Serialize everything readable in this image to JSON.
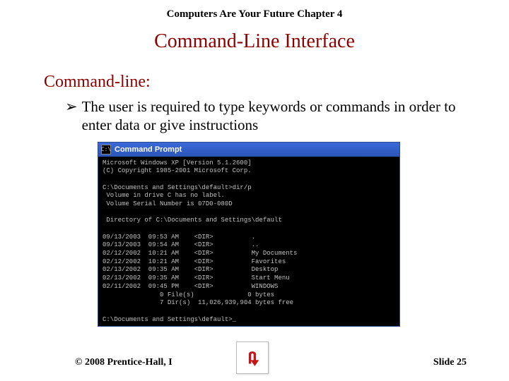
{
  "chapter_header": "Computers Are Your Future  Chapter 4",
  "slide_title": "Command-Line Interface",
  "section_heading": "Command-line:",
  "bullet_glyph": "➢",
  "bullet_text": "The user is required to type keywords or commands in order to enter data or give instructions",
  "cmd_window": {
    "icon_text": "C:\\",
    "title": "Command Prompt",
    "body": "Microsoft Windows XP [Version 5.1.2600]\n(C) Copyright 1985-2001 Microsoft Corp.\n\nC:\\Documents and Settings\\default>dir/p\n Volume in drive C has no label.\n Volume Serial Number is 07D0-080D\n\n Directory of C:\\Documents and Settings\\default\n\n09/13/2003  09:53 AM    <DIR>          .\n09/13/2003  09:54 AM    <DIR>          ..\n02/12/2002  10:21 AM    <DIR>          My Documents\n02/12/2002  10:21 AM    <DIR>          Favorites\n02/13/2002  09:35 AM    <DIR>          Desktop\n02/13/2002  09:35 AM    <DIR>          Start Menu\n02/11/2002  09:45 PM    <DIR>          WINDOWS\n               0 File(s)              0 bytes\n               7 Dir(s)  11,026,939,904 bytes free\n\nC:\\Documents and Settings\\default>_"
  },
  "footer": {
    "copyright": "© 2008 Prentice-Hall, I",
    "slide_number": "Slide 25"
  }
}
